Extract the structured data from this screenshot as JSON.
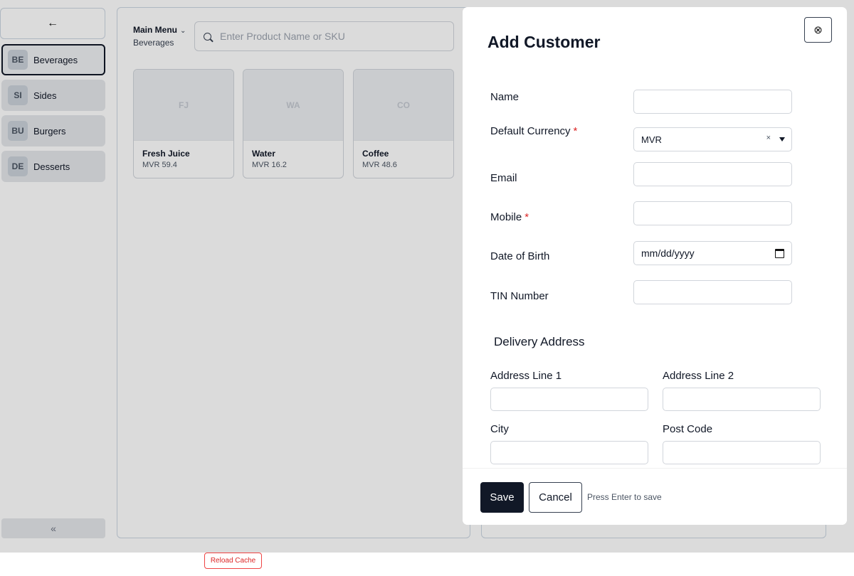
{
  "sidebar": {
    "back_icon": "arrow-left-icon",
    "back_glyph": "←",
    "categories": [
      {
        "badge": "BE",
        "label": "Beverages",
        "active": true
      },
      {
        "badge": "SI",
        "label": "Sides"
      },
      {
        "badge": "BU",
        "label": "Burgers"
      },
      {
        "badge": "DE",
        "label": "Desserts"
      }
    ],
    "collapse_glyph": "«"
  },
  "products": {
    "menu_title": "Main Menu",
    "menu_chevron": "⌄",
    "menu_subtitle": "Beverages",
    "search_placeholder": "Enter Product Name or SKU",
    "items": [
      {
        "initials": "FJ",
        "name": "Fresh Juice",
        "price": "MVR 59.4"
      },
      {
        "initials": "WA",
        "name": "Water",
        "price": "MVR 16.2"
      },
      {
        "initials": "CO",
        "name": "Coffee",
        "price": "MVR 48.6"
      }
    ]
  },
  "reload_cache_label": "Reload Cache",
  "modal": {
    "title": "Add Customer",
    "close_glyph": "⊗",
    "fields": {
      "name_label": "Name",
      "currency_label": "Default Currency",
      "currency_value": "MVR",
      "currency_clear": "×",
      "email_label": "Email",
      "mobile_label": "Mobile",
      "dob_label": "Date of Birth",
      "dob_placeholder": "mm/dd/yyyy",
      "tin_label": "TIN Number",
      "required_mark": "*"
    },
    "delivery": {
      "section_title": "Delivery Address",
      "address1_label": "Address Line 1",
      "address2_label": "Address Line 2",
      "city_label": "City",
      "postcode_label": "Post Code"
    },
    "footer": {
      "save_label": "Save",
      "cancel_label": "Cancel",
      "hint": "Press Enter to save"
    }
  },
  "colors": {
    "primary": "#111827",
    "required": "#dc2626",
    "reload_border": "#ef4444"
  }
}
